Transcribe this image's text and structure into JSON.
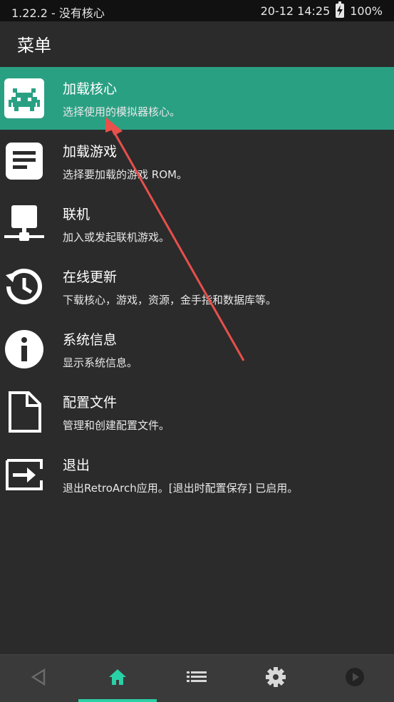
{
  "status_bar": {
    "left_text": "1.22.2 - 没有核心",
    "time": "20-12 14:25",
    "battery": "100%"
  },
  "header": {
    "title": "菜单"
  },
  "menu": [
    {
      "label": "加载核心",
      "sub": "选择使用的模拟器核心。",
      "icon": "retroarch-invader-icon",
      "active": true
    },
    {
      "label": "加载游戏",
      "sub": "选择要加载的游戏 ROM。",
      "icon": "document-lines-icon",
      "active": false
    },
    {
      "label": "联机",
      "sub": "加入或发起联机游戏。",
      "icon": "network-monitor-icon",
      "active": false
    },
    {
      "label": "在线更新",
      "sub": "下载核心，游戏，资源，金手指和数据库等。",
      "icon": "update-clock-icon",
      "active": false
    },
    {
      "label": "系统信息",
      "sub": "显示系统信息。",
      "icon": "info-icon",
      "active": false
    },
    {
      "label": "配置文件",
      "sub": "管理和创建配置文件。",
      "icon": "file-icon",
      "active": false
    },
    {
      "label": "退出",
      "sub": "退出RetroArch应用。[退出时配置保存] 已启用。",
      "icon": "exit-icon",
      "active": false
    }
  ],
  "bottom_nav": [
    {
      "icon": "back-triangle-icon",
      "selected": false
    },
    {
      "icon": "home-icon",
      "selected": true
    },
    {
      "icon": "list-icon",
      "selected": false
    },
    {
      "icon": "gear-icon",
      "selected": false
    },
    {
      "icon": "play-icon",
      "selected": false
    }
  ],
  "colors": {
    "accent": "#2aa083",
    "nav_selected": "#2ad0a6",
    "arrow": "#e8504c",
    "background": "#2b2b2b"
  }
}
